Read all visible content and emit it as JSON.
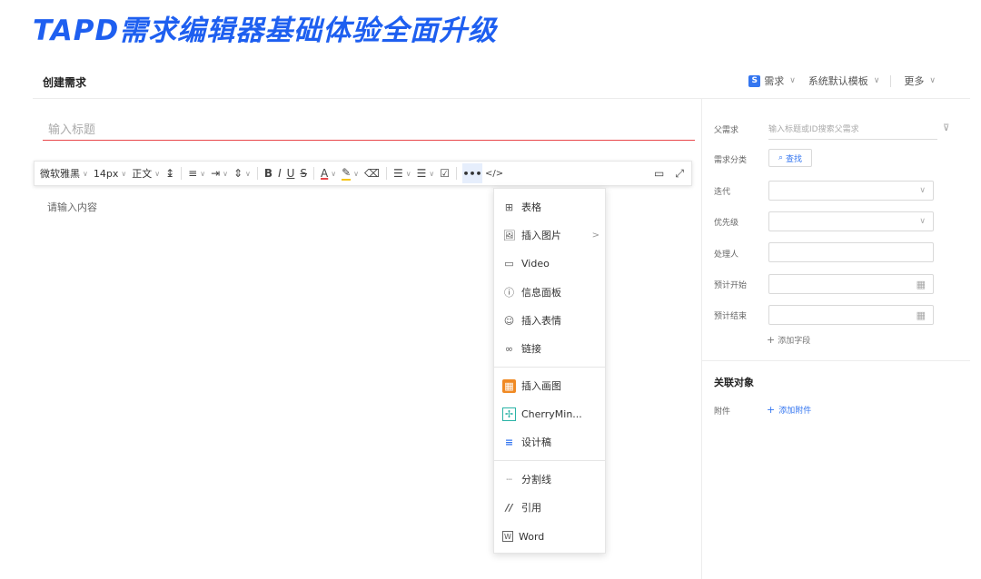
{
  "banner": {
    "title": "TAPD需求编辑器基础体验全面升级"
  },
  "header": {
    "page_title": "创建需求",
    "type_badge": "S",
    "type_label": "需求",
    "template_label": "系统默认模板",
    "more_label": "更多"
  },
  "editor": {
    "title_placeholder": "输入标题",
    "content_placeholder": "请输入内容"
  },
  "toolbar": {
    "font_family": "微软雅黑",
    "font_size": "14px",
    "paragraph_style": "正文",
    "bold": "B",
    "italic": "I",
    "underline": "U",
    "strike": "S",
    "font_color": "A",
    "more": "•••",
    "code": "</>"
  },
  "menu": {
    "items": [
      {
        "label": "表格",
        "icon": "table-icon"
      },
      {
        "label": "插入图片",
        "icon": "image-icon",
        "has_submenu": true
      },
      {
        "label": "Video",
        "icon": "video-icon"
      },
      {
        "label": "信息面板",
        "icon": "info-icon"
      },
      {
        "label": "插入表情",
        "icon": "emoji-icon"
      },
      {
        "label": "链接",
        "icon": "link-icon"
      },
      {
        "label": "插入画图",
        "icon": "drawing-icon"
      },
      {
        "label": "CherryMin...",
        "icon": "mindmap-icon"
      },
      {
        "label": "设计稿",
        "icon": "design-icon"
      },
      {
        "label": "分割线",
        "icon": "divider-icon"
      },
      {
        "label": "引用",
        "icon": "quote-icon"
      },
      {
        "label": "Word",
        "icon": "word-icon"
      }
    ]
  },
  "sidebar": {
    "parent_label": "父需求",
    "parent_placeholder": "输入标题或ID搜索父需求",
    "category_label": "需求分类",
    "search_label": "查找",
    "iteration_label": "迭代",
    "priority_label": "优先级",
    "handler_label": "处理人",
    "start_label": "预计开始",
    "end_label": "预计结束",
    "add_field_label": "添加字段",
    "related_title": "关联对象",
    "attachment_label": "附件",
    "add_attachment_label": "添加附件"
  },
  "colors": {
    "accent": "#3476f0",
    "banner": "#1e5ff0",
    "title_underline": "#e8474a"
  }
}
